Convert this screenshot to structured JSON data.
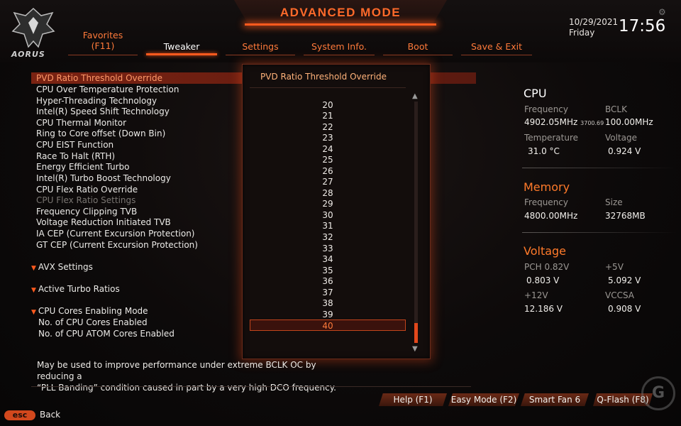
{
  "header": {
    "title": "ADVANCED MODE",
    "brand": "AORUS",
    "date": "10/29/2021",
    "day": "Friday",
    "time": "17:56"
  },
  "tabs": [
    {
      "label": "Favorites",
      "sub": "(F11)"
    },
    {
      "label": "Tweaker"
    },
    {
      "label": "Settings"
    },
    {
      "label": "System Info."
    },
    {
      "label": "Boot"
    },
    {
      "label": "Save & Exit"
    }
  ],
  "settings": [
    "PVD Ratio Threshold Override",
    "CPU Over Temperature Protection",
    "Hyper-Threading Technology",
    "Intel(R) Speed Shift Technology",
    "CPU Thermal Monitor",
    "Ring to Core offset (Down Bin)",
    "CPU EIST Function",
    "Race To Halt (RTH)",
    "Energy Efficient Turbo",
    "Intel(R) Turbo Boost Technology",
    "CPU Flex Ratio Override",
    "CPU Flex Ratio Settings",
    "Frequency Clipping TVB",
    "Voltage Reduction Initiated TVB",
    "IA CEP (Current Excursion Protection)",
    "GT CEP (Current Excursion Protection)"
  ],
  "sections": {
    "avx": "AVX Settings",
    "turbo": "Active Turbo Ratios",
    "cores": "CPU Cores Enabling Mode",
    "cores_items": [
      "No. of CPU Cores Enabled",
      "No. of CPU ATOM Cores Enabled"
    ]
  },
  "popup": {
    "title": "PVD Ratio Threshold Override",
    "options": [
      "20",
      "21",
      "22",
      "23",
      "24",
      "25",
      "26",
      "27",
      "28",
      "29",
      "30",
      "31",
      "32",
      "33",
      "34",
      "35",
      "36",
      "37",
      "38",
      "39",
      "40"
    ],
    "selected": "40"
  },
  "info": {
    "cpu": {
      "title": "CPU",
      "frequency_label": "Frequency",
      "frequency": "4902.05MHz",
      "frequency_sub": "3700.69",
      "bclk_label": "BCLK",
      "bclk": "100.00MHz",
      "temperature_label": "Temperature",
      "temperature": "31.0 °C",
      "voltage_label": "Voltage",
      "voltage": "0.924 V"
    },
    "memory": {
      "title": "Memory",
      "frequency_label": "Frequency",
      "frequency": "4800.00MHz",
      "size_label": "Size",
      "size": "32768MB"
    },
    "voltage": {
      "title": "Voltage",
      "pch_label": "PCH 0.82V",
      "pch": "0.803 V",
      "v5_label": "+5V",
      "v5": "5.092 V",
      "v12_label": "+12V",
      "v12": "12.186 V",
      "vccsa_label": "VCCSA",
      "vccsa": "0.908 V"
    }
  },
  "help_text": {
    "line1": "May be used to improve performance under extreme BCLK OC by reducing a",
    "line2": "“PLL Banding” condition caused in part by a very high DCO frequency."
  },
  "footer": {
    "buttons": [
      "Help (F1)",
      "Easy Mode (F2)",
      "Smart Fan 6 (F6)",
      "Q-Flash (F8)"
    ],
    "esc_key": "esc",
    "esc_label": "Back"
  },
  "colors": {
    "accent": "#ff5a1e",
    "accent_text": "#ff7a2a",
    "background": "#0d0a0a"
  }
}
